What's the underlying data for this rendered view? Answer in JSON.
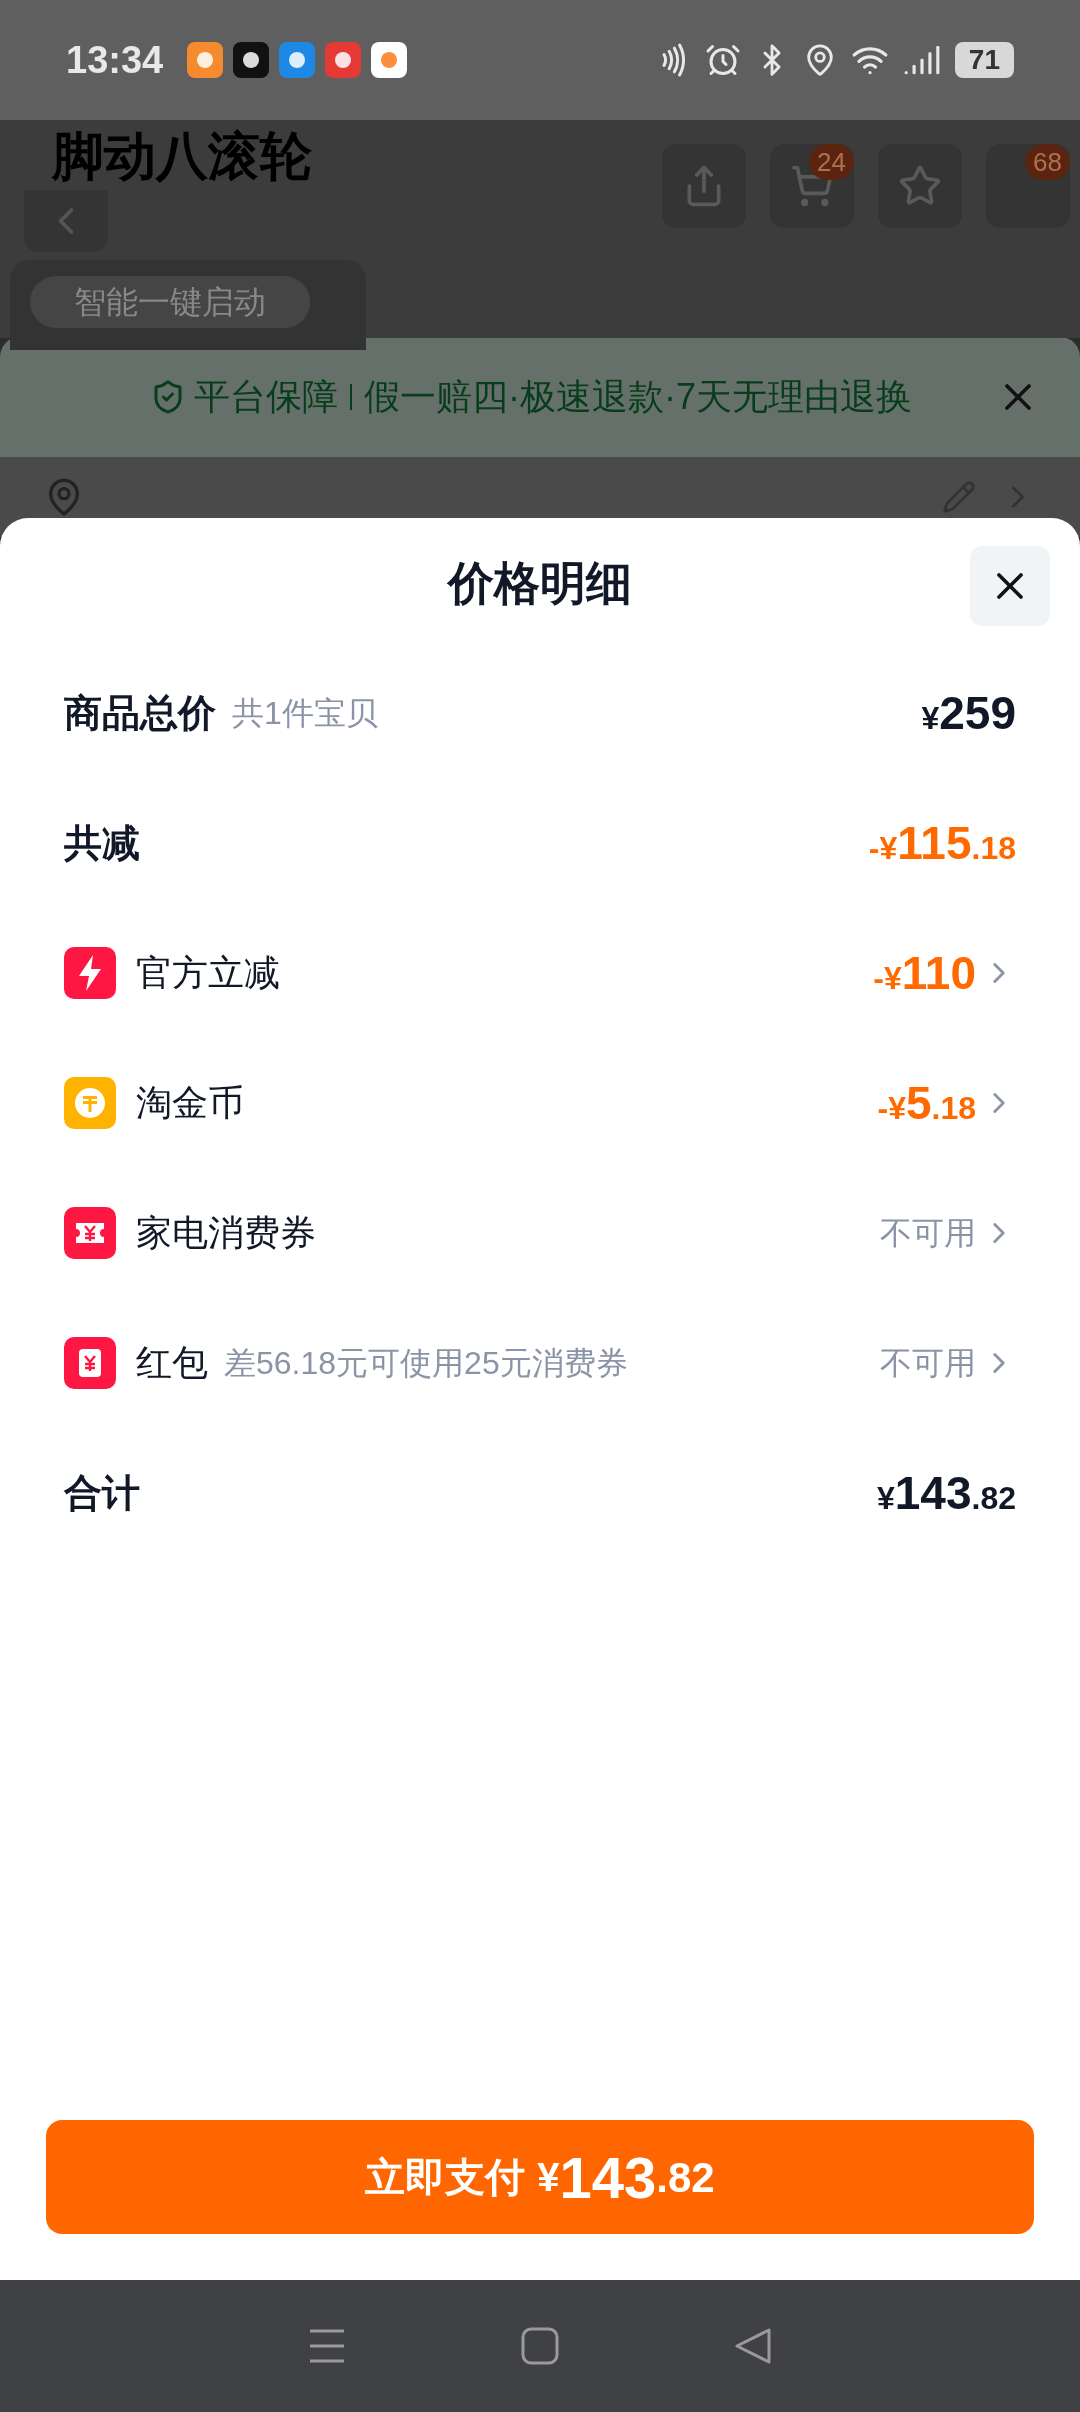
{
  "status_bar": {
    "time": "13:34",
    "battery": "71"
  },
  "background_page": {
    "title": "脚动八滚轮",
    "cart_badge": "24",
    "message_badge": "68",
    "feature_tag": "智能一键启动",
    "guarantee": {
      "label": "平台保障",
      "details": "假一赔四·极速退款·7天无理由退换"
    }
  },
  "sheet": {
    "title": "价格明细",
    "rows": [
      {
        "kind": "summary",
        "label": "商品总价",
        "note": "共1件宝贝",
        "value": {
          "prefix": "¥",
          "main": "259"
        },
        "highlight": false
      },
      {
        "kind": "summary",
        "label": "共减",
        "value": {
          "prefix": "-¥",
          "main": "115",
          "decimal": ".18"
        },
        "highlight": true
      },
      {
        "kind": "item",
        "label": "官方立减",
        "value": {
          "prefix": "-¥",
          "main": "110"
        },
        "highlight": true
      },
      {
        "kind": "item",
        "label": "淘金币",
        "value": {
          "prefix": "-¥",
          "main": "5",
          "decimal": ".18"
        },
        "highlight": true
      },
      {
        "kind": "item",
        "label": "家电消费券",
        "status": "不可用"
      },
      {
        "kind": "item",
        "label": "红包",
        "note": "差56.18元可使用25元消费券",
        "status": "不可用"
      },
      {
        "kind": "summary",
        "label": "合计",
        "value": {
          "prefix": "¥",
          "main": "143",
          "decimal": ".82"
        },
        "highlight": false
      }
    ],
    "pay_button": {
      "label": "立即支付",
      "prefix": "¥",
      "main": "143",
      "decimal": ".82"
    }
  }
}
